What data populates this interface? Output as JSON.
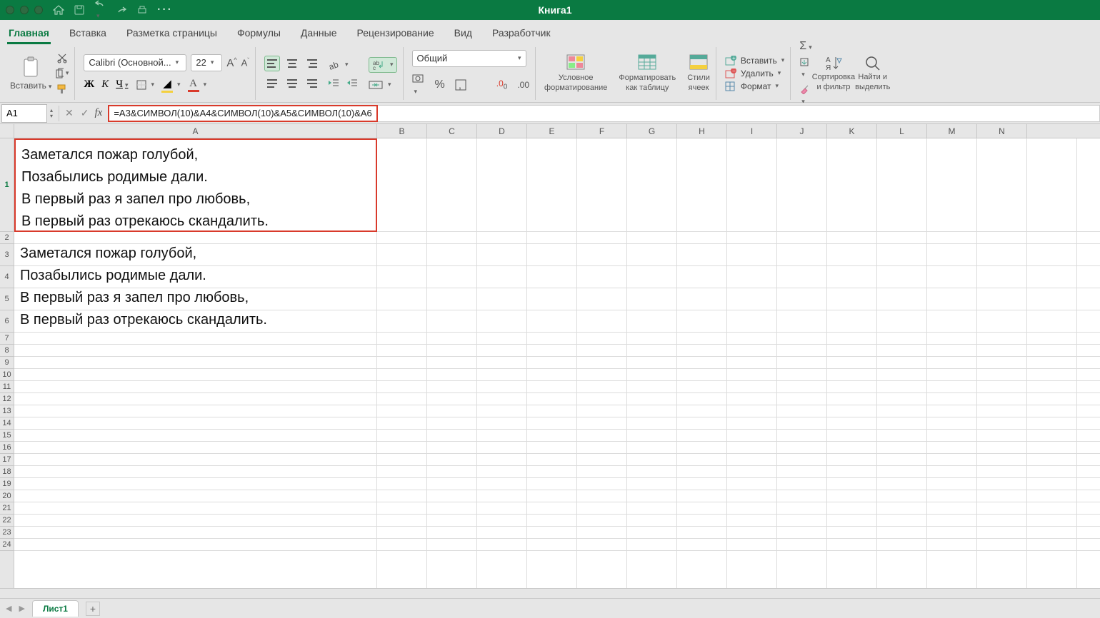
{
  "title": "Книга1",
  "tabs": [
    "Главная",
    "Вставка",
    "Разметка страницы",
    "Формулы",
    "Данные",
    "Рецензирование",
    "Вид",
    "Разработчик"
  ],
  "activeTab": 0,
  "ribbon": {
    "paste": "Вставить",
    "fontName": "Calibri (Основной...",
    "fontSize": "22",
    "numberFormat": "Общий",
    "condFormat": [
      "Условное",
      "форматирование"
    ],
    "formatTable": [
      "Форматировать",
      "как таблицу"
    ],
    "cellStyles": [
      "Стили",
      "ячеек"
    ],
    "insert": "Вставить",
    "delete": "Удалить",
    "format": "Формат",
    "sortFilter": [
      "Сортировка",
      "и фильтр"
    ],
    "findSelect": [
      "Найти и",
      "выделить"
    ]
  },
  "nameBox": "A1",
  "formula": "=A3&СИМВОЛ(10)&A4&СИМВОЛ(10)&A5&СИМВОЛ(10)&A6",
  "columns": [
    "A",
    "B",
    "C",
    "D",
    "E",
    "F",
    "G",
    "H",
    "I",
    "J",
    "K",
    "L",
    "M",
    "N"
  ],
  "cellA1": "Заметался пожар голубой,\nПозабылись родимые дали.\nВ первый раз я запел про любовь,\nВ первый раз отрекаюсь скандалить.",
  "rowData": {
    "3": "Заметался пожар голубой,",
    "4": "Позабылись родимые дали.",
    "5": "В первый раз я запел про любовь,",
    "6": "В первый раз отрекаюсь скандалить."
  },
  "sheet": "Лист1"
}
